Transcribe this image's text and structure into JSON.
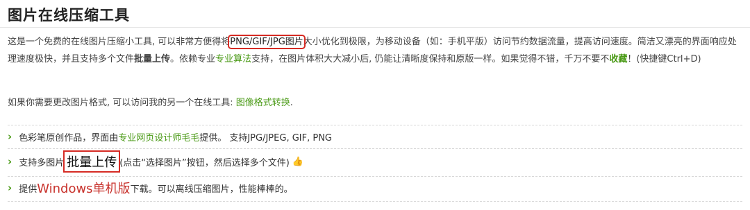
{
  "page": {
    "title": "图片在线压缩工具"
  },
  "intro": {
    "part1": "这是一个免费的在线图片压缩小工具, 可以非常方便得将",
    "formats_boxed": "PNG/GIF/JPG图片",
    "part2": "大小优化到极限，为移动设备（如：手机平版）访问节约数据流量，提高访问速度。简洁又漂亮的界面响应处理速度极快，并且支持多个文件",
    "batch_bold": "批量上传",
    "part3": "。依赖专业",
    "algo_link": "专业算法",
    "part4": "支持，在图片体积大大减小后, 仍能让清晰度保持和原版一样。如果觉得不错，千万不要不",
    "fav_link": "收藏",
    "part5": "！(快捷键Ctrl+D)"
  },
  "format_line": {
    "text": "如果你需要更改图片格式, 可以访问我的另一个在线工具: ",
    "link": "图像格式转换",
    "end": "."
  },
  "features": [
    {
      "icon": "green-chevron-right-icon",
      "before": "色彩笔原创作品，界面由",
      "link": "专业网页设计师毛毛",
      "after": "提供。 支持JPG/JPEG, GIF, PNG"
    },
    {
      "icon": "green-chevron-right-icon",
      "before": "支持多图片",
      "emphasis": "批量上传",
      "after": "(点击“选择图片”按钮，然后选择多个文件)",
      "emoji": "👍"
    },
    {
      "icon": "green-chevron-right-icon",
      "before": "提供",
      "emphasis": "Windows单机版",
      "after": "下载。可以离线压缩图片，性能棒棒的。"
    }
  ],
  "colors": {
    "accent_green": "#4a9a16",
    "highlight_red": "#d62b24",
    "text": "#333333"
  }
}
